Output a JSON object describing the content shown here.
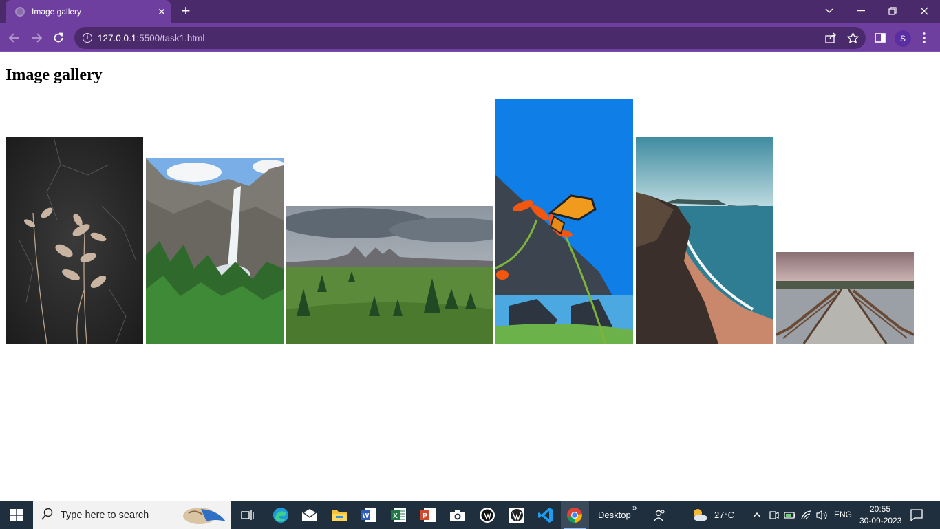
{
  "browser": {
    "tab_title": "Image gallery",
    "tab_close": "✕",
    "new_tab": "+",
    "url_host": "127.0.0.1",
    "url_rest": ":5500/task1.html",
    "profile_initial": "S"
  },
  "page": {
    "title": "Image gallery"
  },
  "gallery": {
    "images": [
      {
        "name": "dried-leaves-photo"
      },
      {
        "name": "waterfall-photo"
      },
      {
        "name": "meadow-mountains-photo"
      },
      {
        "name": "butterfly-photo"
      },
      {
        "name": "coastline-photo"
      },
      {
        "name": "boardwalk-pier-photo"
      }
    ]
  },
  "taskbar": {
    "search_placeholder": "Type here to search",
    "desktop_label": "Desktop",
    "chevron": "»",
    "temperature": "27°C",
    "language": "ENG",
    "time": "20:55",
    "date": "30-09-2023"
  },
  "colors": {
    "chrome_dark": "#4b2a6b",
    "chrome_light": "#6f3fa0",
    "taskbar": "#1f2f3e"
  }
}
